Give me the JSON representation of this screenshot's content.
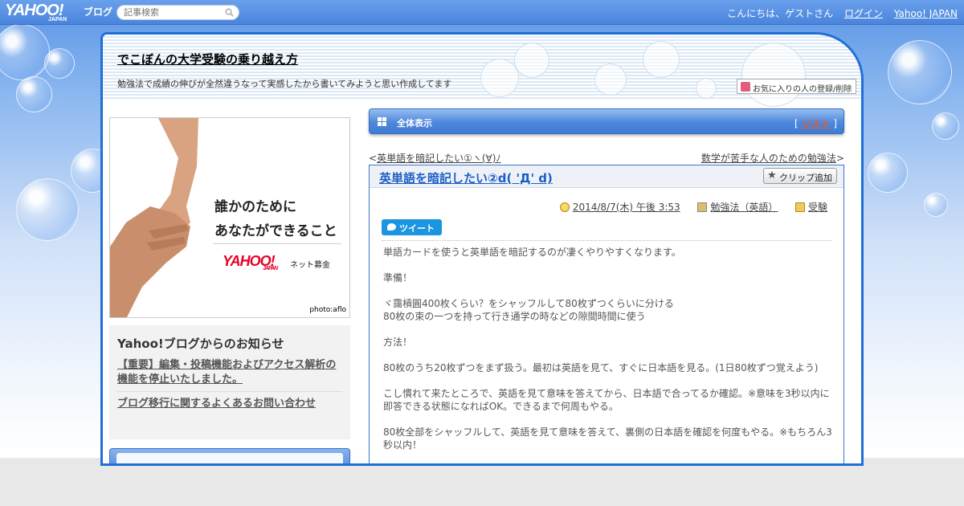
{
  "topbar": {
    "logo": "YAHOO!",
    "logo_sub": "JAPAN",
    "logo_blog": "ブログ",
    "search_placeholder": "記事検索",
    "greeting": "こんにちは、ゲストさん",
    "login": "ログイン",
    "yahoo_japan": "Yahoo! JAPAN"
  },
  "blog": {
    "title": "でこぼんの大学受験の乗り越え方",
    "description": "勉強法で成績の伸びが全然違うなって実感したから書いてみようと思い作成してます",
    "fav_button": "お気に入りの人の登録/削除"
  },
  "ad": {
    "line1": "誰かのために",
    "line2": "あなたができること",
    "logo": "YAHOO!",
    "logo_sub": "JAPAN",
    "service": "ネット募金",
    "credit": "photo:aflo"
  },
  "notice": {
    "heading": "Yahoo!ブログからのお知らせ",
    "items": [
      "【重要】編集・投稿機能およびアクセス解析の機能を停止いたしました。",
      "ブログ移行に関するよくあるお問い合わせ"
    ]
  },
  "all_bar": {
    "label": "全体表示",
    "bracket_open": "[",
    "list_link": "リスト",
    "bracket_close": "]"
  },
  "post_nav": {
    "prev_prefix": "<",
    "prev": "英単語を暗記したい①ヽ(∀)ﾉ",
    "next": "数学が苦手な人のための勉強法",
    "next_suffix": ">"
  },
  "article": {
    "title": "英単語を暗記したい②d( 'Д' d)",
    "clip_button": "クリップ追加",
    "date": "2014/8/7(木) 午後 3:53",
    "category": "勉強法（英語）",
    "tag": "受験",
    "tweet_button": "ツイート",
    "body": [
      "単語カードを使うと英単語を暗記するのが凄くやりやすくなります。",
      "",
      "準備！",
      "",
      "ヾ靄槓圓400枚くらい？をシャッフルして80枚ずつくらいに分ける",
      "80枚の束の一つを持って行き通学の時などの隙間時間に使う",
      "",
      "方法！",
      "",
      "80枚のうち20枚ずつをまず扱う。最初は英語を見て、すぐに日本語を見る。(1日80枚ずつ覚えよう)",
      "",
      "こし慣れて来たところで、英語を見て意味を答えてから、日本語で合ってるか確認。※意味を3秒以内に即答できる状態になればOK。できるまで何周もやる。",
      "",
      "80枚全部をシャッフルして、英語を見て意味を答えて、裏側の日本語を確認を何度もやる。※もちろん3秒以内！"
    ]
  }
}
